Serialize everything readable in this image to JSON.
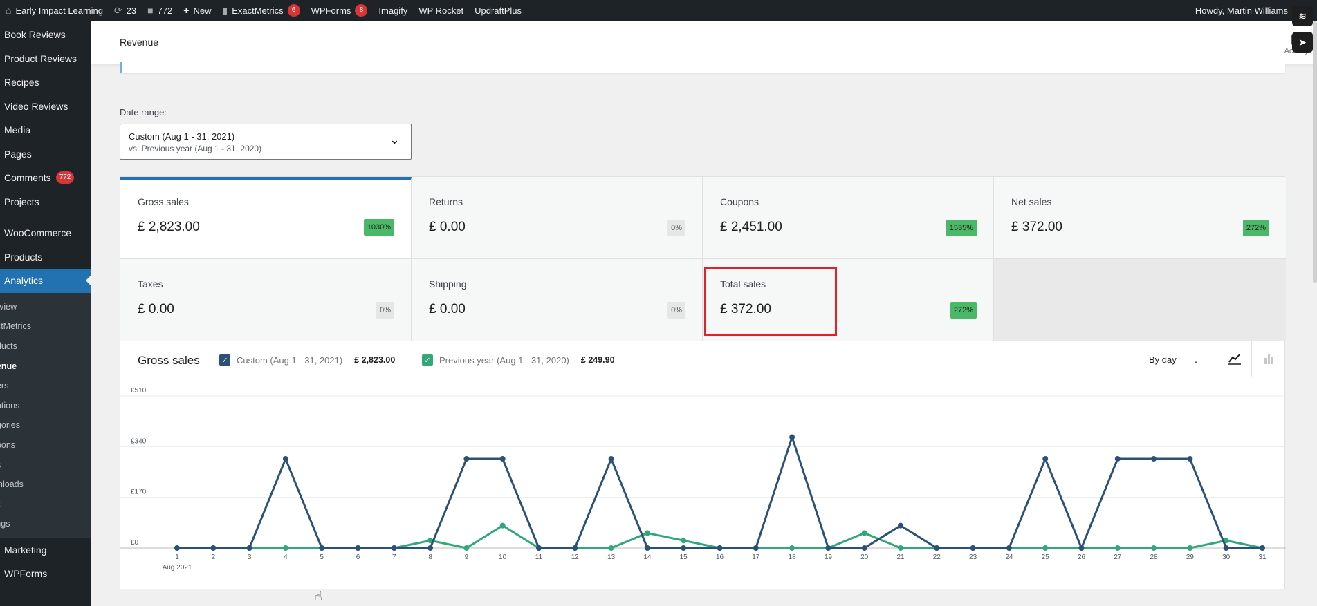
{
  "admin_bar": {
    "site_name": "Early Impact Learning",
    "updates_count": "23",
    "comments_count": "772",
    "new_label": "New",
    "exactmetrics_label": "ExactMetrics",
    "exactmetrics_badge": "6",
    "wpforms_label": "WPForms",
    "wpforms_badge": "8",
    "imagify_label": "Imagify",
    "wprocket_label": "WP Rocket",
    "updraft_label": "UpdraftPlus",
    "howdy": "Howdy, Martin Williams"
  },
  "sidebar": {
    "items_top": [
      {
        "label": "Book Reviews"
      },
      {
        "label": "Product Reviews"
      },
      {
        "label": "Recipes"
      },
      {
        "label": "Video Reviews"
      },
      {
        "label": "Media"
      },
      {
        "label": "Pages"
      },
      {
        "label": "Comments",
        "badge": "772"
      },
      {
        "label": "Projects"
      }
    ],
    "woocommerce": "WooCommerce",
    "products": "Products",
    "analytics": "Analytics",
    "submenu": [
      "erview",
      "actMetrics",
      "oducts",
      "venue",
      "ders",
      "riations",
      "egories",
      "upons",
      "es",
      "wnloads",
      "ck",
      "tings"
    ],
    "marketing": "Marketing",
    "wpforms": "WPForms"
  },
  "header": {
    "title": "Revenue",
    "activity_label": "Activity"
  },
  "date_range": {
    "label": "Date range:",
    "primary": "Custom (Aug 1 - 31, 2021)",
    "secondary": "vs. Previous year (Aug 1 - 31, 2020)"
  },
  "cards": [
    {
      "label": "Gross sales",
      "value": "£ 2,823.00",
      "delta": "1030%",
      "trend": "up"
    },
    {
      "label": "Returns",
      "value": "£ 0.00",
      "delta": "0%",
      "trend": "neutral"
    },
    {
      "label": "Coupons",
      "value": "£ 2,451.00",
      "delta": "1535%",
      "trend": "up"
    },
    {
      "label": "Net sales",
      "value": "£ 372.00",
      "delta": "272%",
      "trend": "up"
    },
    {
      "label": "Taxes",
      "value": "£ 0.00",
      "delta": "0%",
      "trend": "neutral"
    },
    {
      "label": "Shipping",
      "value": "£ 0.00",
      "delta": "0%",
      "trend": "neutral"
    },
    {
      "label": "Total sales",
      "value": "£ 372.00",
      "delta": "272%",
      "trend": "up"
    }
  ],
  "chart": {
    "title": "Gross sales",
    "legend": [
      {
        "name": "Custom (Aug 1 - 31, 2021)",
        "total": "£ 2,823.00",
        "color": "#2c5177"
      },
      {
        "name": "Previous year (Aug 1 - 31, 2020)",
        "total": "£ 249.90",
        "color": "#32a77a"
      }
    ],
    "interval": "By day",
    "first_tick_sub": "Aug 2021"
  },
  "colors": {
    "accent": "#2271b1",
    "series_current": "#2c5177",
    "series_previous": "#32a77a",
    "positive_badge": "#4ab866",
    "highlight": "#e0202b"
  },
  "chart_data": {
    "type": "line",
    "title": "Gross sales",
    "x": [
      1,
      2,
      3,
      4,
      5,
      6,
      7,
      8,
      9,
      10,
      11,
      12,
      13,
      14,
      15,
      16,
      17,
      18,
      19,
      20,
      21,
      22,
      23,
      24,
      25,
      26,
      27,
      28,
      29,
      30,
      31
    ],
    "y_ticks": [
      "£0",
      "£170",
      "£340",
      "£510"
    ],
    "ylim": [
      0,
      510
    ],
    "grid": true,
    "series": [
      {
        "name": "Custom (Aug 1 - 31, 2021)",
        "values": [
          0,
          0,
          0,
          299,
          0,
          0,
          0,
          0,
          299,
          299,
          0,
          0,
          299,
          0,
          0,
          0,
          0,
          372,
          0,
          0,
          75,
          0,
          0,
          0,
          299,
          0,
          299,
          299,
          299,
          0,
          0
        ]
      },
      {
        "name": "Previous year (Aug 1 - 31, 2020)",
        "values": [
          0,
          0,
          0,
          0,
          0,
          0,
          0,
          25,
          0,
          75,
          0,
          0,
          0,
          50,
          25,
          0,
          0,
          0,
          0,
          50,
          0,
          0,
          0,
          0,
          0,
          0,
          0,
          0,
          0,
          25,
          0
        ]
      }
    ]
  }
}
